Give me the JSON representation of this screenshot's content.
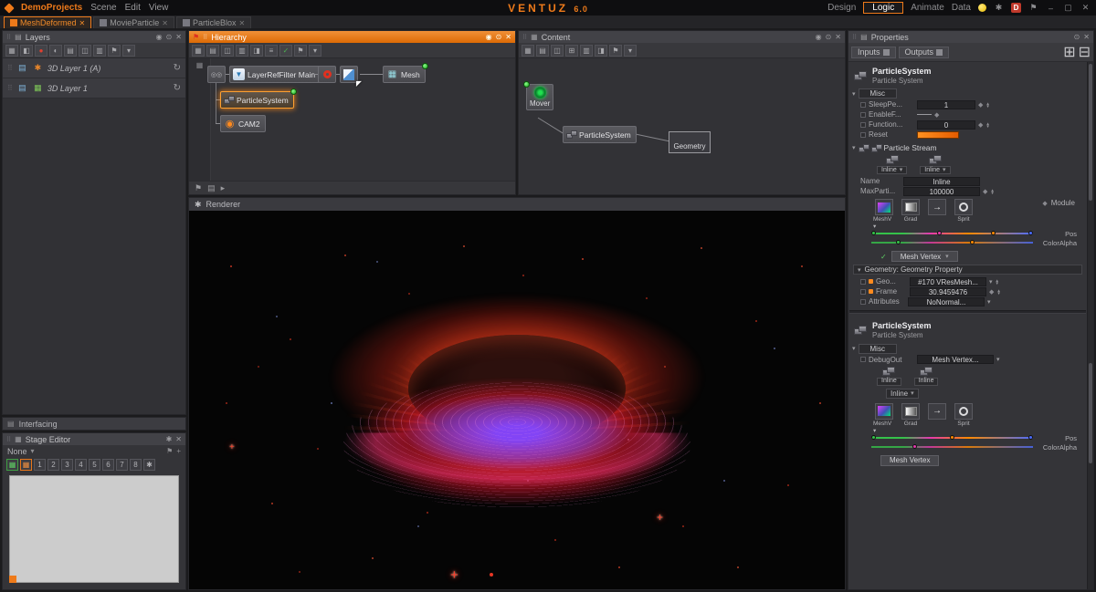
{
  "icons": {
    "close": "✕",
    "eye": "◉",
    "target": "⊙",
    "pin": "⚑",
    "flag": "⚑",
    "caret_down": "▾",
    "caret_right": "▸",
    "check": "✓",
    "refresh": "↻",
    "grip": "⠿",
    "up": "▲",
    "down": "▼",
    "diamond": "◆",
    "arrow": "→",
    "minimize": "–",
    "maximize": "▢",
    "gear": "✱",
    "doc": "▤",
    "grid": "▦",
    "cursor": "◤",
    "ring": "◎",
    "plus": "+",
    "spark": "+",
    "funnel": "▼",
    "cam": "◉",
    "mesh": "▦",
    "menu": "≡"
  },
  "titlebar": {
    "project": "DemoProjects",
    "menus": [
      "Scene",
      "Edit",
      "View"
    ],
    "app_name": "VENTUZ",
    "app_version": "6.0",
    "modes": [
      "Design",
      "Logic",
      "Animate",
      "Data"
    ],
    "d_badge": "D"
  },
  "doc_tabs": [
    {
      "label": "MeshDeformed"
    },
    {
      "label": "MovieParticle"
    },
    {
      "label": "ParticleBlox"
    }
  ],
  "layers": {
    "title": "Layers",
    "items": [
      {
        "label": "3D Layer 1 (A)"
      },
      {
        "label": "3D Layer 1"
      }
    ]
  },
  "layers_toolbar": [
    "▦",
    "◧",
    "●",
    "◐",
    "▤",
    "◫",
    "▥",
    "⚑",
    "▾"
  ],
  "interfacing": {
    "title": "Interfacing"
  },
  "stage": {
    "title": "Stage Editor",
    "preset": "None",
    "slots": [
      "1",
      "2",
      "3",
      "4",
      "5",
      "6",
      "7",
      "8"
    ]
  },
  "hierarchy": {
    "title": "Hierarchy",
    "node1": "LayerRefFilter Main",
    "node2": "Mesh",
    "node3": "ParticleSystem",
    "node4": "CAM2"
  },
  "hierarchy_toolbar": [
    "▦",
    "▤",
    "◫",
    "▥",
    "◨",
    "≡",
    "✓",
    "⚑",
    "▾"
  ],
  "content": {
    "title": "Content",
    "node_mover": "Mover",
    "node_ps": "ParticleSystem",
    "node_geo": "Geometry"
  },
  "content_toolbar": [
    "▦",
    "▤",
    "◫",
    "⊞",
    "▥",
    "◨",
    "⚑",
    "▾"
  ],
  "renderer": {
    "title": "Renderer"
  },
  "props": {
    "title": "Properties",
    "tab_inputs": "Inputs",
    "tab_outputs": "Outputs",
    "s1": {
      "name": "ParticleSystem",
      "type": "Particle System",
      "misc": "Misc",
      "row_sleep_label": "SleepPe...",
      "row_sleep_value": "1",
      "row_enable_label": "EnableF...",
      "row_func_label": "Function...",
      "row_func_value": "0",
      "row_reset_label": "Reset",
      "stream": "Particle Stream",
      "inline_a": "Inline",
      "inline_b": "Inline",
      "name_label": "Name",
      "name_value": "Inline",
      "max_label": "MaxParti...",
      "max_value": "100000",
      "module": "Module",
      "box_mesh": "MeshV",
      "box_grad": "Grad",
      "box_sprite": "Sprit",
      "pos": "Pos",
      "coloralpha": "ColorAlpha",
      "mesh_vertex": "Mesh Vertex",
      "geometry_header": "Geometry:  Geometry Property",
      "geo_label": "Geo...",
      "geo_value": "#170  VResMesh...",
      "frame_label": "Frame",
      "frame_value": "30.9459476",
      "attr_label": "Attributes",
      "attr_value": "NoNormal..."
    },
    "s2": {
      "name": "ParticleSystem",
      "type": "Particle System",
      "misc": "Misc",
      "debug_label": "DebugOut",
      "debug_value": "Mesh Vertex...",
      "inline_a": "Inline",
      "inline_b": "Inline",
      "inline_dd": "Inline",
      "box_mesh": "MeshV",
      "box_grad": "Grad",
      "box_sprite": "Sprit",
      "pos": "Pos",
      "coloralpha": "ColorAlpha",
      "mesh_vertex": "Mesh Vertex"
    }
  }
}
